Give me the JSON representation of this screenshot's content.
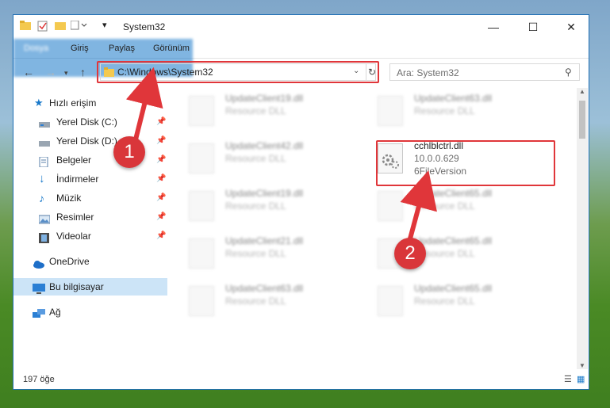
{
  "window": {
    "title": "System32",
    "controls": {
      "minimize": "—",
      "maximize": "☐",
      "close": "✕"
    }
  },
  "ribbon": {
    "tabs": [
      "Dosya",
      "Giriş",
      "Paylaş",
      "Görünüm"
    ]
  },
  "address_bar": {
    "path": "C:\\Windows\\System32",
    "search_placeholder": "Ara: System32"
  },
  "sidebar": {
    "items": [
      {
        "label": "Hızlı erişim",
        "icon": "star-icon",
        "pinned": false
      },
      {
        "label": "Yerel Disk (C:)",
        "icon": "drive-icon",
        "pinned": true
      },
      {
        "label": "Yerel Disk (D:)",
        "icon": "drive-icon",
        "pinned": true
      },
      {
        "label": "Belgeler",
        "icon": "documents-icon",
        "pinned": true
      },
      {
        "label": "İndirmeler",
        "icon": "download-icon",
        "pinned": true
      },
      {
        "label": "Müzik",
        "icon": "music-icon",
        "pinned": true
      },
      {
        "label": "Resimler",
        "icon": "pictures-icon",
        "pinned": true
      },
      {
        "label": "Videolar",
        "icon": "video-icon",
        "pinned": true
      },
      {
        "label": "OneDrive",
        "icon": "cloud-icon",
        "pinned": false
      },
      {
        "label": "Bu bilgisayar",
        "icon": "computer-icon",
        "pinned": false,
        "selected": true
      },
      {
        "label": "Ağ",
        "icon": "network-icon",
        "pinned": false
      }
    ]
  },
  "files": [
    {
      "name": "UpdateClient19.dll",
      "type": "Resource DLL"
    },
    {
      "name": "UpdateClient63.dll",
      "type": "Resource DLL"
    },
    {
      "name": "UpdateClient42.dll",
      "type": "Resource DLL"
    },
    {
      "name": "cchlblctrl.dll",
      "version": "10.0.0.629",
      "type": "6FileVersion"
    },
    {
      "name": "UpdateClient19.dll",
      "type": "Resource DLL"
    },
    {
      "name": "UpdateClient65.dll",
      "type": "Resource DLL"
    },
    {
      "name": "UpdateClient21.dll",
      "type": "Resource DLL"
    },
    {
      "name": "UpdateClient65.dll",
      "type": "Resource DLL"
    },
    {
      "name": "UpdateClient63.dll",
      "type": "Resource DLL"
    },
    {
      "name": "UpdateClient65.dll",
      "type": "Resource DLL"
    }
  ],
  "status": {
    "item_count": "197 öğe"
  },
  "annotations": {
    "step1": "1",
    "step2": "2",
    "color": "#e0363a"
  }
}
